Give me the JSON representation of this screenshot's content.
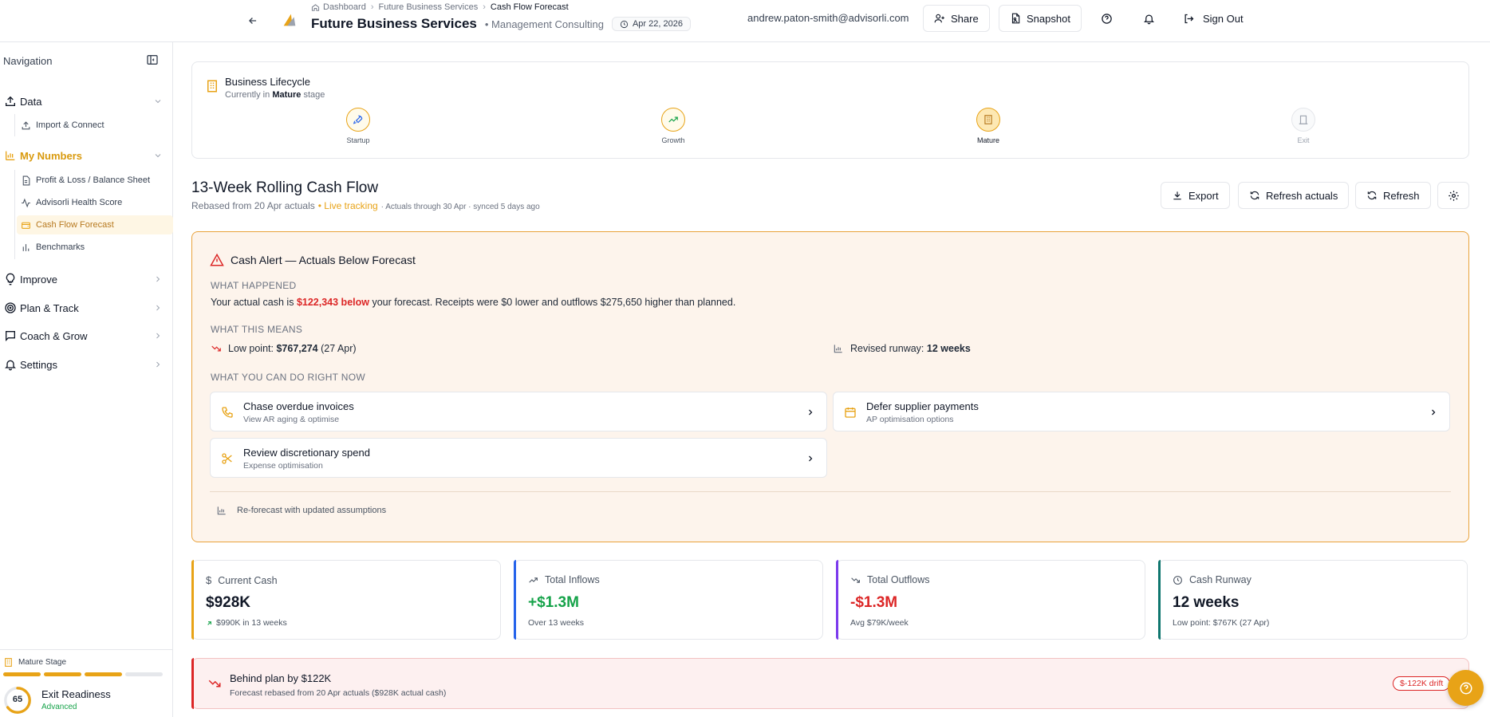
{
  "header": {
    "breadcrumb": [
      "Dashboard",
      "Future Business Services",
      "Cash Flow Forecast"
    ],
    "company_name": "Future Business Services",
    "industry": "• Management Consulting",
    "date": "Apr 22, 2026",
    "user_email": "andrew.paton-smith@advisorli.com",
    "share_label": "Share",
    "snapshot_label": "Snapshot",
    "signout_label": "Sign Out"
  },
  "sidebar": {
    "title": "Navigation",
    "groups": [
      {
        "label": "Data",
        "items": [
          "Import & Connect"
        ]
      },
      {
        "label": "My Numbers",
        "items": [
          "Profit & Loss / Balance Sheet",
          "Advisorli Health Score",
          "Cash Flow Forecast",
          "Benchmarks"
        ]
      },
      {
        "label": "Improve"
      },
      {
        "label": "Plan & Track"
      },
      {
        "label": "Coach & Grow"
      },
      {
        "label": "Settings"
      }
    ],
    "footer": {
      "stage_label": "Mature Stage",
      "stage_progress": 0.75,
      "readiness_score": "65",
      "readiness_fraction": 0.65,
      "exit_title": "Exit Readiness",
      "exit_level": "Advanced"
    }
  },
  "lifecycle": {
    "title": "Business Lifecycle",
    "sub_prefix": "Currently in",
    "current_stage": "Mature",
    "sub_suffix": "stage",
    "stages": [
      "Startup",
      "Growth",
      "Mature",
      "Exit"
    ]
  },
  "page": {
    "title": "13-Week Rolling Cash Flow",
    "sub_main": "Rebased from 20 Apr actuals",
    "sub_live": "• Live tracking",
    "sub_meta": "· Actuals through 30 Apr · synced 5 days ago",
    "export_label": "Export",
    "refresh_actuals_label": "Refresh actuals",
    "refresh_label": "Refresh"
  },
  "alert": {
    "title": "Cash Alert — Actuals Below Forecast",
    "what_happened_heading": "WHAT HAPPENED",
    "what_happened_pre": "Your actual cash is",
    "what_happened_amount": "$122,343 below",
    "what_happened_post": "your forecast. Receipts were $0 lower and outflows $275,650 higher than planned.",
    "what_means_heading": "WHAT THIS MEANS",
    "low_point_label": "Low point:",
    "low_point_value": "$767,274",
    "low_point_date": "(27 Apr)",
    "runway_label": "Revised runway:",
    "runway_value": "12 weeks",
    "actions_heading": "WHAT YOU CAN DO RIGHT NOW",
    "actions": [
      {
        "title": "Chase overdue invoices",
        "sub": "View AR aging & optimise",
        "icon": "phone-icon"
      },
      {
        "title": "Defer supplier payments",
        "sub": "AP optimisation options",
        "icon": "calendar-icon"
      },
      {
        "title": "Review discretionary spend",
        "sub": "Expense optimisation",
        "icon": "scissors-icon"
      }
    ],
    "reforecast_label": "Re-forecast with updated assumptions"
  },
  "kpis": [
    {
      "label": "Current Cash",
      "value": "$928K",
      "sub": "$990K in 13 weeks",
      "color": "#e8a317",
      "value_color": "#111827"
    },
    {
      "label": "Total Inflows",
      "value": "+$1.3M",
      "sub": "Over 13 weeks",
      "color": "#2563eb",
      "value_color": "#16a34a"
    },
    {
      "label": "Total Outflows",
      "value": "-$1.3M",
      "sub": "Avg $79K/week",
      "color": "#7c3aed",
      "value_color": "#dc2626"
    },
    {
      "label": "Cash Runway",
      "value": "12 weeks",
      "sub": "Low point: $767K (27 Apr)",
      "color": "#0f766e",
      "value_color": "#111827"
    }
  ],
  "behind": {
    "title": "Behind plan by $122K",
    "sub": "Forecast rebased from 20 Apr actuals ($928K actual cash)",
    "badge": "$-122K drift"
  },
  "colors": {
    "accent": "#e8a317",
    "negative": "#dc2626",
    "positive": "#16a34a"
  }
}
